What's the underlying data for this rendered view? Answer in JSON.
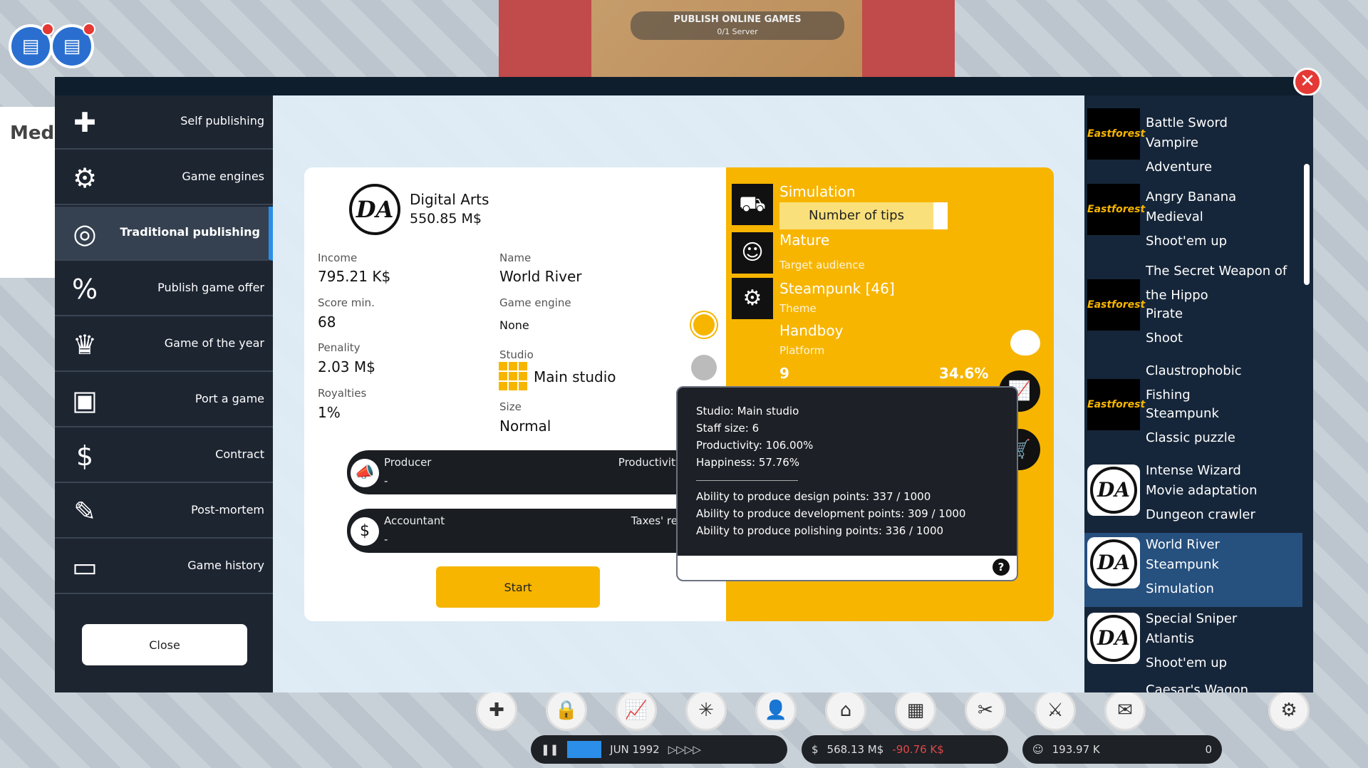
{
  "topbar": {
    "server_title": "PUBLISH ONLINE GAMES",
    "server_sub": "0/1 Server"
  },
  "background": {
    "left_title": "Medi"
  },
  "nav": {
    "items": [
      {
        "label": "Self publishing",
        "icon": "gamepad-cross-icon"
      },
      {
        "label": "Game engines",
        "icon": "gamepad-gear-icon"
      },
      {
        "label": "Traditional publishing",
        "icon": "coin-stack-icon"
      },
      {
        "label": "Publish game offer",
        "icon": "percent-bubble-icon"
      },
      {
        "label": "Game of the year",
        "icon": "trophy-icon"
      },
      {
        "label": "Port a game",
        "icon": "devices-icon"
      },
      {
        "label": "Contract",
        "icon": "dollar-hand-icon"
      },
      {
        "label": "Post-mortem",
        "icon": "clipboard-icon"
      },
      {
        "label": "Game history",
        "icon": "monitor-icon"
      }
    ],
    "close_label": "Close"
  },
  "publisher": {
    "name": "Digital Arts",
    "money": "550.85 M$",
    "logo_text": "DA"
  },
  "details": {
    "income_label": "Income",
    "income": "795.21 K$",
    "score_label": "Score min.",
    "score": "68",
    "penalty_label": "Penality",
    "penalty": "2.03 M$",
    "royalties_label": "Royalties",
    "royalties": "1%",
    "name_label": "Name",
    "name": "World River",
    "engine_label": "Game engine",
    "engine": "None",
    "studio_label": "Studio",
    "studio": "Main studio",
    "size_label": "Size",
    "size": "Normal"
  },
  "staff": {
    "producer_label": "Producer",
    "producer_value": "-",
    "producer_right": "Productivity bonus",
    "accountant_label": "Accountant",
    "accountant_value": "-",
    "accountant_right": "Taxes' reduction"
  },
  "start_label": "Start",
  "game_info": {
    "genre": "Simulation",
    "tips_label": "Number of tips",
    "audience": "Mature",
    "audience_label": "Target audience",
    "theme": "Steampunk [46]",
    "theme_label": "Theme",
    "platform": "Handboy",
    "platform_label": "Platform",
    "stat_left": "9",
    "stat_right": "34.6%"
  },
  "tooltip": {
    "lines": [
      "Studio: Main studio",
      "Staff size: 6",
      "Productivity: 106.00%",
      "Happiness: 57.76%"
    ],
    "abilities": [
      "Ability to produce design points: 337 / 1000",
      "Ability to produce development points: 309 / 1000",
      "Ability to produce polishing points: 336 / 1000"
    ],
    "help": "?"
  },
  "game_list": [
    {
      "title": "Battle Sword",
      "theme": "Vampire",
      "genre": "Adventure",
      "logo": "ff"
    },
    {
      "title": "Angry Banana",
      "theme": "Medieval",
      "genre": "Shoot'em up",
      "logo": "ff"
    },
    {
      "title": "The Secret Weapon of",
      "title2": "the Hippo",
      "theme": "Pirate",
      "genre": "Shoot",
      "logo": "ff"
    },
    {
      "title": "Claustrophobic",
      "title2": "Fishing",
      "theme": "Steampunk",
      "genre": "Classic puzzle",
      "logo": "ff"
    },
    {
      "title": "Intense Wizard",
      "theme": "Movie adaptation",
      "genre": "Dungeon crawler",
      "logo": "da"
    },
    {
      "title": "World River",
      "theme": "Steampunk",
      "genre": "Simulation",
      "logo": "da"
    },
    {
      "title": "Special Sniper",
      "theme": "Atlantis",
      "genre": "Shoot'em up",
      "logo": "da"
    },
    {
      "title": "Caesar's Wagon",
      "logo": "da"
    }
  ],
  "ff_logo_text": "Eastforest",
  "hud": {
    "date": "JUN 1992",
    "money": "568.13 M$",
    "delta": "-90.76 K$",
    "fans": "193.97 K",
    "count": "0"
  }
}
